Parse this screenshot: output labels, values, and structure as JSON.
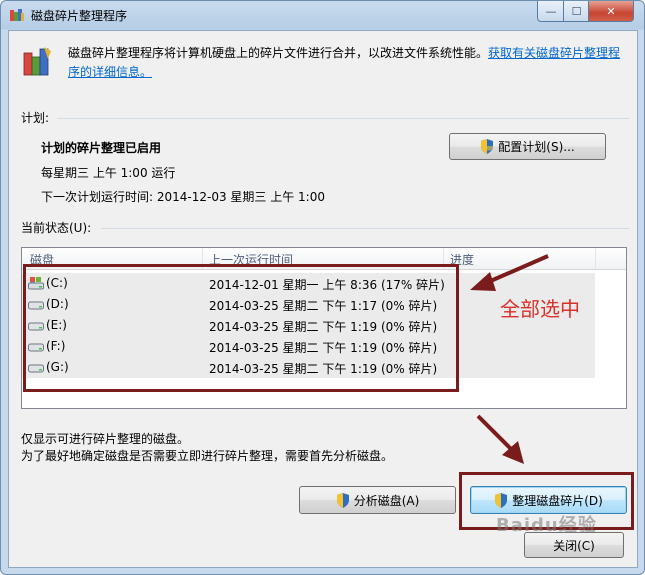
{
  "window": {
    "title": "磁盘碎片整理程序",
    "controls": {
      "minimize": "—",
      "maximize": "☐",
      "close": "✕"
    }
  },
  "intro": {
    "text": "磁盘碎片整理程序将计算机硬盘上的碎片文件进行合并，以改进文件系统性能。",
    "link": "获取有关磁盘碎片整理程序的详细信息。"
  },
  "schedule": {
    "section_label": "计划:",
    "status": "计划的碎片整理已启用",
    "frequency": "每星期三  上午 1:00 运行",
    "next_run": "下一次计划运行时间: 2014-12-03 星期三 上午 1:00",
    "configure_button": "配置计划(S)..."
  },
  "current_status": {
    "section_label": "当前状态(U):",
    "columns": [
      "磁盘",
      "上一次运行时间",
      "进度"
    ],
    "rows": [
      {
        "drive": "(C:)",
        "last_run": "2014-12-01 星期一 上午 8:36 (17% 碎片)",
        "icon": "system-drive-icon"
      },
      {
        "drive": "(D:)",
        "last_run": "2014-03-25 星期二 下午 1:17 (0% 碎片)",
        "icon": "drive-icon"
      },
      {
        "drive": "(E:)",
        "last_run": "2014-03-25 星期二 下午 1:19 (0% 碎片)",
        "icon": "drive-icon"
      },
      {
        "drive": "(F:)",
        "last_run": "2014-03-25 星期二 下午 1:19 (0% 碎片)",
        "icon": "drive-icon"
      },
      {
        "drive": "(G:)",
        "last_run": "2014-03-25 星期二 下午 1:19 (0% 碎片)",
        "icon": "drive-icon"
      }
    ]
  },
  "notes": {
    "line1": "仅显示可进行碎片整理的磁盘。",
    "line2": "为了最好地确定磁盘是否需要立即进行碎片整理，需要首先分析磁盘。"
  },
  "buttons": {
    "analyze": "分析磁盘(A)",
    "defragment": "整理磁盘碎片(D)",
    "close": "关闭(C)"
  },
  "annotation": {
    "text": "全部选中",
    "color": "#d9302a",
    "box_color": "#7a1c1c"
  },
  "watermark": "Baidu经验"
}
